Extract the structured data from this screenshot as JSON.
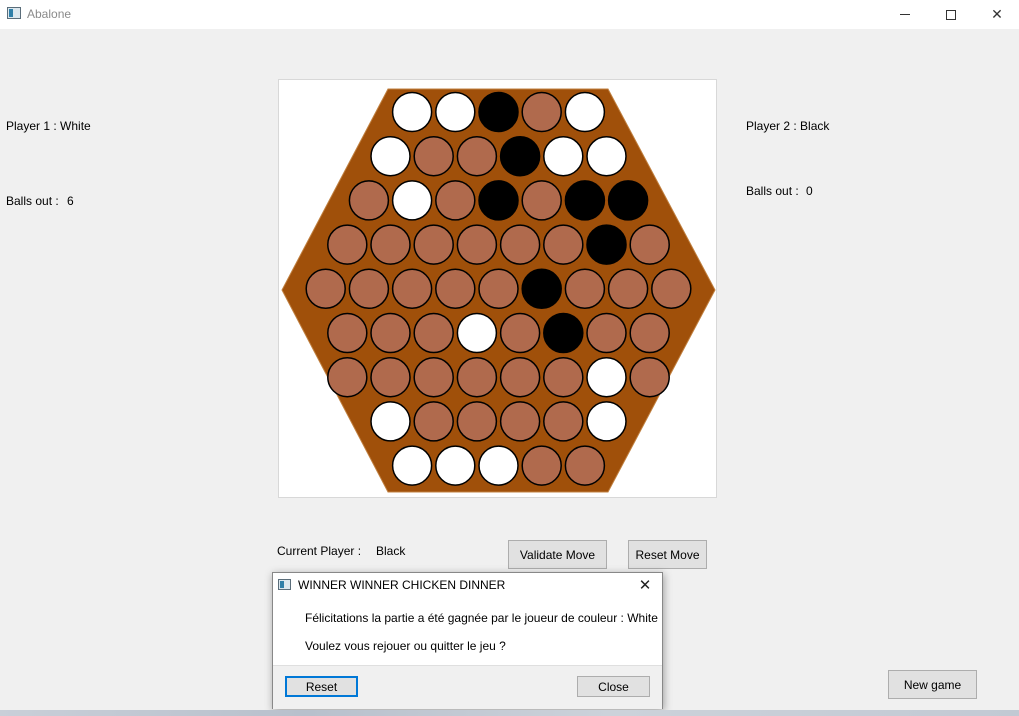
{
  "window": {
    "title": "Abalone",
    "minimize_icon": "minimize-icon",
    "maximize_icon": "maximize-icon",
    "close_icon": "close-icon"
  },
  "player1": {
    "label": "Player 1 : White",
    "balls_out_label": "Balls out :",
    "balls_out": "6"
  },
  "player2": {
    "label": "Player 2 : Black",
    "balls_out_label": "Balls out :",
    "balls_out": "0"
  },
  "status": {
    "current_player_label": "Current Player :",
    "current_player": "Black"
  },
  "buttons": {
    "validate": "Validate Move",
    "reset_move": "Reset Move",
    "new_game": "New game"
  },
  "colors": {
    "board": "#a0500a",
    "empty_cell": "#b06a4d",
    "white_ball": "#ffffff",
    "black_ball": "#000000"
  },
  "board": {
    "legend": "W = white ball, B = black ball, . = empty cell",
    "rows": [
      "WWB.W",
      "W..BWW",
      ".W.B.BB",
      "......B.",
      ".....B...",
      "...W.B..",
      "......W.",
      "W....W",
      "WWW.."
    ]
  },
  "dialog": {
    "title": "WINNER WINNER CHICKEN DINNER",
    "message": "Félicitations la partie a été gagnée par le joueur de couleur : White",
    "question": "Voulez vous rejouer ou quitter le jeu ?",
    "reset": "Reset",
    "close": "Close"
  }
}
